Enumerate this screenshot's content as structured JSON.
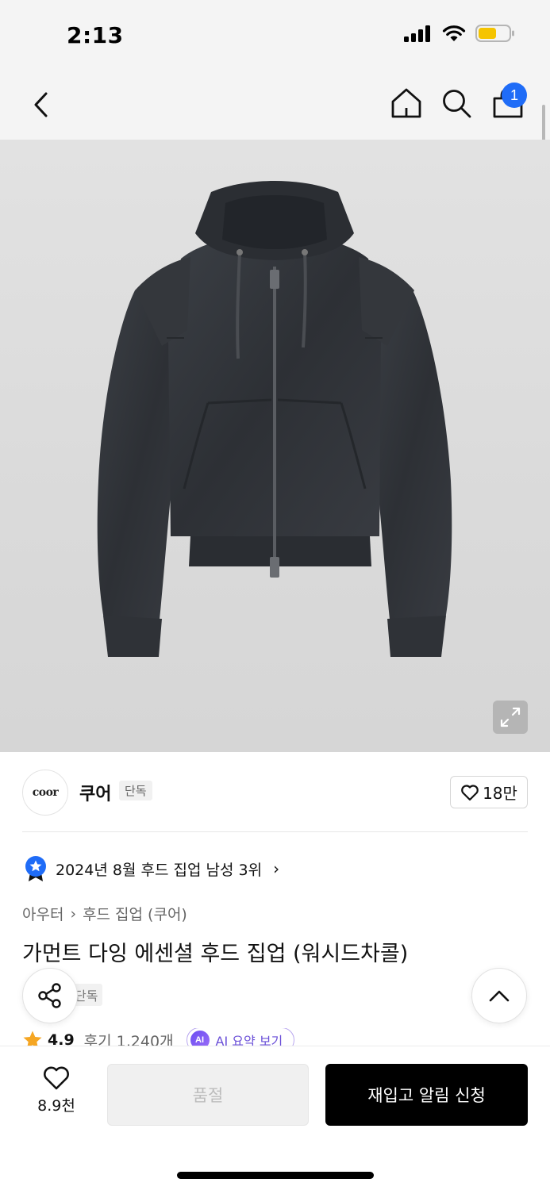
{
  "status_bar": {
    "time": "2:13",
    "icons": [
      "cellular-signal-icon",
      "wifi-icon",
      "battery-icon"
    ],
    "battery_color": "#f5c400"
  },
  "nav": {
    "icons": [
      "back-chevron-icon",
      "home-icon",
      "search-icon",
      "shopping-bag-icon"
    ],
    "cart_badge": "1",
    "badge_color": "#1f6cf7"
  },
  "brand": {
    "logo_text": "coor",
    "name": "쿠어",
    "tag": "단독",
    "like_count": "18만"
  },
  "ranking": {
    "text": "2024년 8월 후드 집업 남성 3위",
    "chevron": "›"
  },
  "breadcrumb": {
    "parent": "아우터",
    "separator": "›",
    "current": "후드 집업 (쿠어)"
  },
  "product": {
    "title": "가먼트 다잉 에센셜 후드 집업 (워시드차콜)",
    "exclusive_tag": "단독",
    "rating": "4.9",
    "reviews": "후기 1,240개",
    "ai_badge": "AI",
    "ai_summary_label": "AI 요약 보기"
  },
  "bottom_bar": {
    "wish_count": "8.9천",
    "soldout_label": "품절",
    "restock_label": "재입고 알림 신청"
  },
  "colors": {
    "accent_blue": "#1f6cf7",
    "ai_purple": "#6a4fd8",
    "primary_black": "#000000",
    "star_orange": "#f5a623"
  }
}
